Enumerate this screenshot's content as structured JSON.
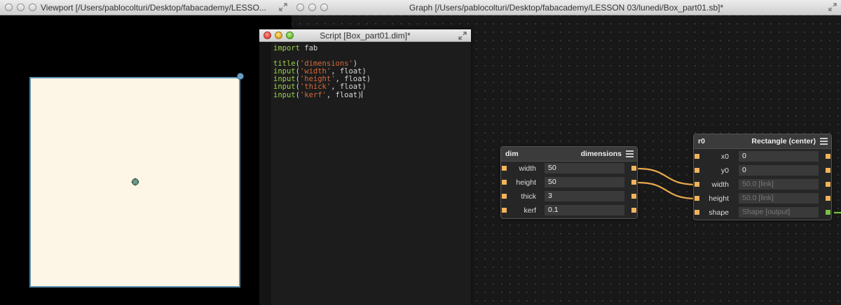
{
  "viewport": {
    "title": "Viewport [/Users/pablocolturi/Desktop/fabacademy/LESSO..."
  },
  "graph": {
    "title": "Graph [/Users/pablocolturi/Desktop/fabacademy/LESSON 03/lunedi/Box_part01.sb]*"
  },
  "script": {
    "title": "Script [Box_part01.dim]*",
    "lines": [
      [
        {
          "t": "import",
          "c": "kw"
        },
        {
          "t": " fab",
          "c": "txt"
        }
      ],
      [],
      [
        {
          "t": "title",
          "c": "fn"
        },
        {
          "t": "(",
          "c": "txt"
        },
        {
          "t": "'dimensions'",
          "c": "str"
        },
        {
          "t": ")",
          "c": "txt"
        }
      ],
      [
        {
          "t": "input",
          "c": "fn"
        },
        {
          "t": "(",
          "c": "txt"
        },
        {
          "t": "'width'",
          "c": "str"
        },
        {
          "t": ", float)",
          "c": "txt"
        }
      ],
      [
        {
          "t": "input",
          "c": "fn"
        },
        {
          "t": "(",
          "c": "txt"
        },
        {
          "t": "'height'",
          "c": "str"
        },
        {
          "t": ", float)",
          "c": "txt"
        }
      ],
      [
        {
          "t": "input",
          "c": "fn"
        },
        {
          "t": "(",
          "c": "txt"
        },
        {
          "t": "'thick'",
          "c": "str"
        },
        {
          "t": ", float)",
          "c": "txt"
        }
      ],
      [
        {
          "t": "input",
          "c": "fn"
        },
        {
          "t": "(",
          "c": "txt"
        },
        {
          "t": "'kerf'",
          "c": "str"
        },
        {
          "t": ", float)",
          "c": "txt"
        }
      ]
    ]
  },
  "dim_node": {
    "name": "dim",
    "type": "dimensions",
    "rows": [
      {
        "label": "width",
        "value": "50"
      },
      {
        "label": "height",
        "value": "50"
      },
      {
        "label": "thick",
        "value": "3"
      },
      {
        "label": "kerf",
        "value": "0.1"
      }
    ]
  },
  "rect_node": {
    "name": "r0",
    "type": "Rectangle (center)",
    "rows": [
      {
        "label": "x0",
        "value": "0",
        "linked": false
      },
      {
        "label": "y0",
        "value": "0",
        "linked": false
      },
      {
        "label": "width",
        "value": "50.0 [link]",
        "linked": true
      },
      {
        "label": "height",
        "value": "50.0 [link]",
        "linked": true
      },
      {
        "label": "shape",
        "value": "Shape [output]",
        "linked": true
      }
    ]
  },
  "colors": {
    "port": "#f2b35a",
    "output_port": "#7bc043",
    "wire": "#e8a94e",
    "canvas_fill": "#fdf6e6",
    "canvas_border": "#5d8fb0"
  }
}
